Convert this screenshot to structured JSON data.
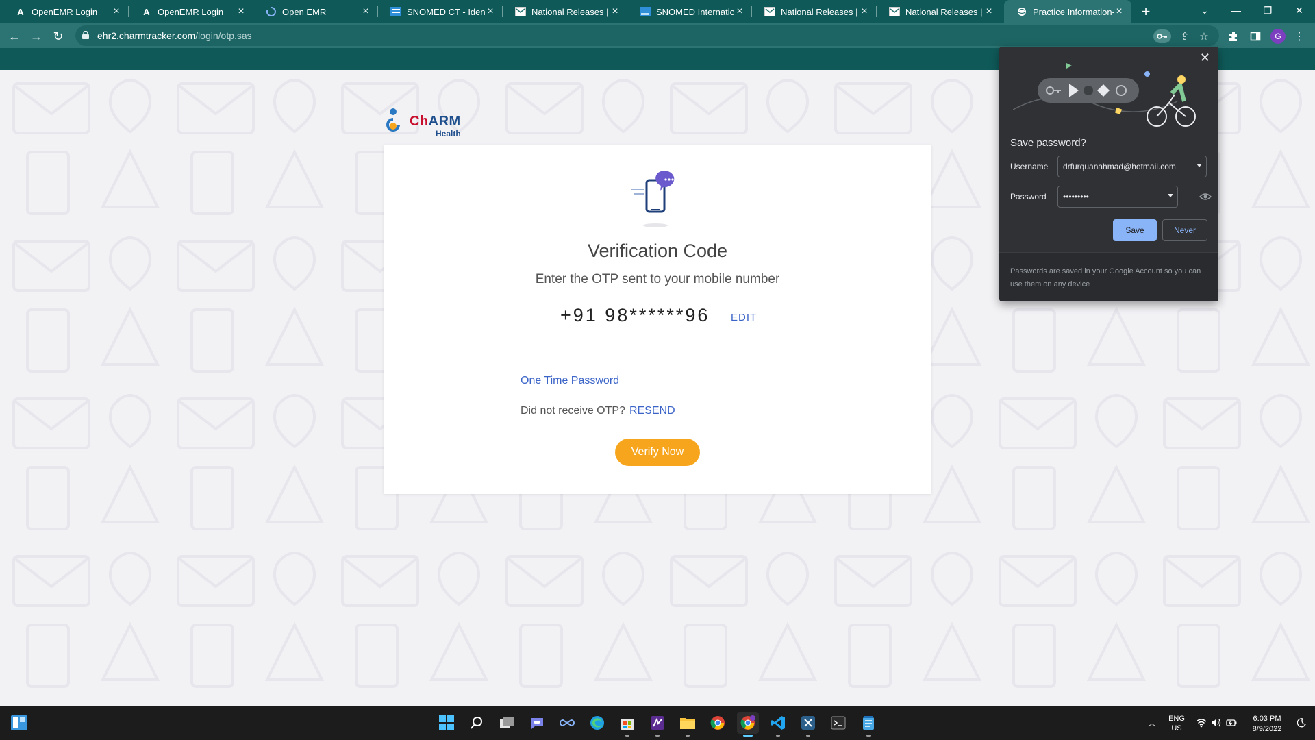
{
  "browser": {
    "tabs": [
      {
        "title": "OpenEMR Login",
        "icon": "openemr-icon"
      },
      {
        "title": "OpenEMR Login",
        "icon": "openemr-icon"
      },
      {
        "title": "Open EMR",
        "icon": "loading-icon"
      },
      {
        "title": "SNOMED CT - Identifie",
        "icon": "snomed-icon"
      },
      {
        "title": "National Releases | NF",
        "icon": "nrc-icon"
      },
      {
        "title": "SNOMED Internationa",
        "icon": "snomed-icon"
      },
      {
        "title": "National Releases | NF",
        "icon": "nrc-icon"
      },
      {
        "title": "National Releases | NF",
        "icon": "nrc-icon"
      },
      {
        "title": "Practice Information-C",
        "icon": "globe-icon",
        "active": true
      }
    ],
    "url_host": "ehr2.charmtracker.com",
    "url_path": "/login/otp.sas",
    "profile_initial": "G",
    "accent_color": "#2b7473"
  },
  "logo": {
    "brand": "Ch",
    "brand_accent": "ARM",
    "sub": "Health"
  },
  "otp_card": {
    "title": "Verification Code",
    "subtitle": "Enter the OTP sent to your mobile number",
    "phone": "+91 98******96",
    "edit_label": "EDIT",
    "otp_placeholder": "One Time Password",
    "otp_value": "",
    "resend_prompt": "Did not receive OTP?",
    "resend_label": "RESEND",
    "verify_label": "Verify Now",
    "verify_color": "#f7a51c"
  },
  "save_password_popup": {
    "heading": "Save password?",
    "username_label": "Username",
    "username_value": "drfurquanahmad@hotmail.com",
    "password_label": "Password",
    "password_value": "•••••••••",
    "save_label": "Save",
    "never_label": "Never",
    "footer_note": "Passwords are saved in your Google Account so you can use them on any device"
  },
  "taskbar": {
    "apps": [
      "search-icon",
      "task-view-icon",
      "teams-chat-icon",
      "link-icon",
      "edge-icon",
      "store-icon",
      "visual-studio-icon",
      "file-explorer-icon",
      "chrome-icon",
      "chrome-profile-icon",
      "vscode-icon",
      "snipping-icon",
      "terminal-icon",
      "notepad-icon"
    ],
    "language_line1": "ENG",
    "language_line2": "US",
    "time": "6:03 PM",
    "date": "8/9/2022"
  }
}
